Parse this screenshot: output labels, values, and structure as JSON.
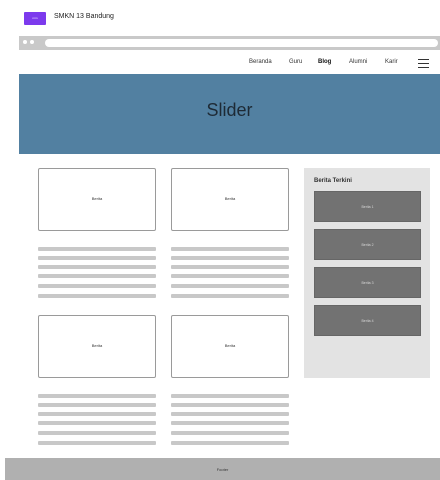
{
  "header": {
    "logo_text": "mm",
    "school_name": "SMKN 13 Bandung"
  },
  "nav": {
    "items": [
      {
        "label": "Beranda"
      },
      {
        "label": "Guru"
      },
      {
        "label": "Blog"
      },
      {
        "label": "Alumni"
      },
      {
        "label": "Karir"
      }
    ],
    "active": "Blog"
  },
  "slider": {
    "title": "Slider"
  },
  "posts": [
    {
      "label": "Berita"
    },
    {
      "label": "Berita"
    },
    {
      "label": "Berita"
    },
    {
      "label": "Berita"
    }
  ],
  "sidebar": {
    "title": "Berita Terkini",
    "items": [
      {
        "label": "Berita 1"
      },
      {
        "label": "Berita 2"
      },
      {
        "label": "Berita 3"
      },
      {
        "label": "Berita 4"
      }
    ]
  },
  "footer": {
    "label": "Footer"
  }
}
